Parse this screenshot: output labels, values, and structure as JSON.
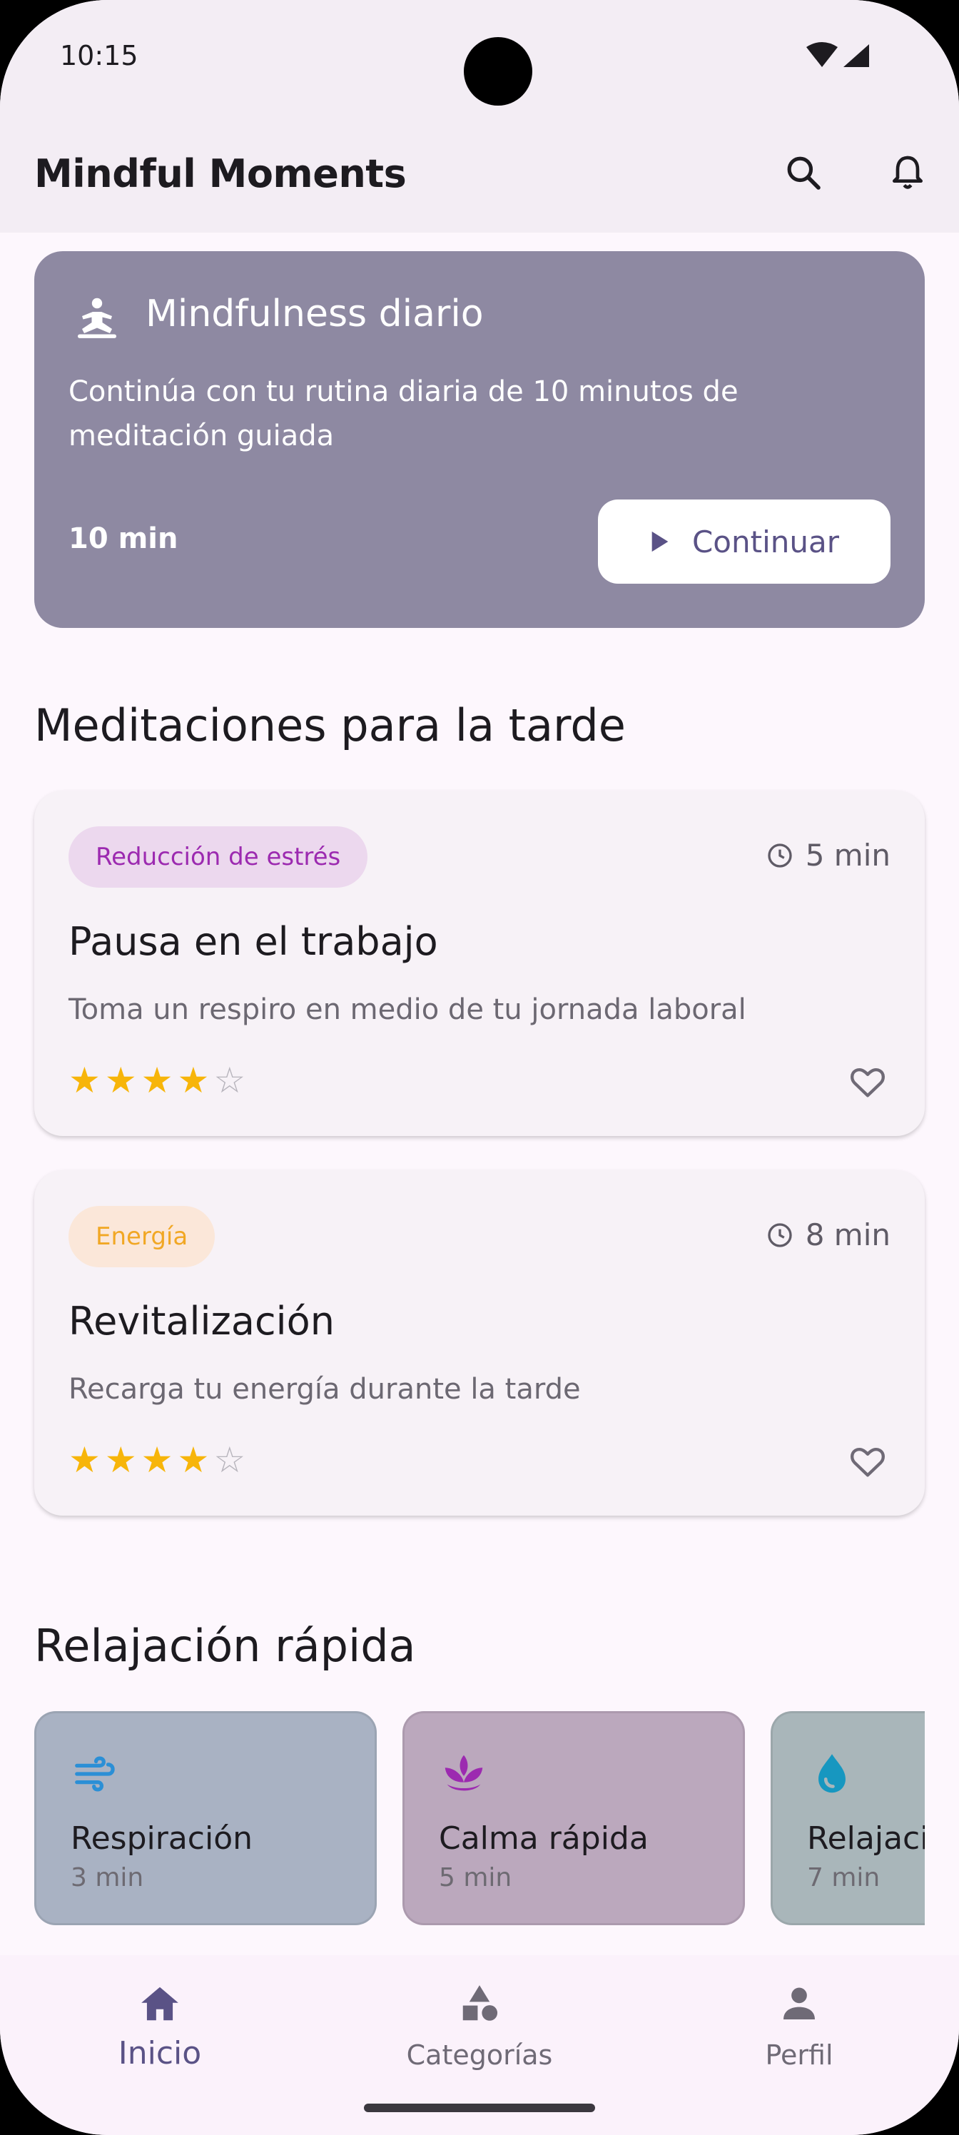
{
  "status_bar": {
    "time": "10:15"
  },
  "app_bar": {
    "title": "Mindful Moments"
  },
  "hero": {
    "title": "Mindfulness diario",
    "description": "Continúa con tu rutina diaria de 10 minutos de meditación guiada",
    "duration": "10 min",
    "button_label": "Continuar"
  },
  "afternoon": {
    "section_title": "Meditaciones para la tarde",
    "cards": [
      {
        "tag": "Reducción de estrés",
        "duration": "5 min",
        "title": "Pausa en el trabajo",
        "description": "Toma un respiro en medio de tu jornada laboral",
        "rating": 4,
        "max_rating": 5
      },
      {
        "tag": "Energía",
        "duration": "8 min",
        "title": "Revitalización",
        "description": "Recarga tu energía durante la tarde",
        "rating": 4,
        "max_rating": 5
      }
    ]
  },
  "quick": {
    "section_title": "Relajación rápida",
    "items": [
      {
        "title": "Respiración",
        "duration": "3 min",
        "icon": "wind-icon",
        "bg": "#a9b2c3",
        "icon_color": "#2b8fd6"
      },
      {
        "title": "Calma rápida",
        "duration": "5 min",
        "icon": "lotus-icon",
        "bg": "#bba8bd",
        "icon_color": "#9c2ab0"
      },
      {
        "title": "Relajación",
        "duration": "7 min",
        "icon": "water-drop-icon",
        "bg": "#a9b6ba",
        "icon_color": "#1797c0"
      }
    ]
  },
  "bottom_nav": {
    "items": [
      {
        "label": "Inicio",
        "icon": "home-icon",
        "active": true
      },
      {
        "label": "Categorías",
        "icon": "categories-icon",
        "active": false
      },
      {
        "label": "Perfil",
        "icon": "person-icon",
        "active": false
      }
    ]
  },
  "colors": {
    "primary": "#5a5286",
    "hero_bg": "#8e89a2",
    "star": "#f7b50a",
    "tag_stress": "#9c2ab0",
    "tag_energy": "#f1a724"
  }
}
